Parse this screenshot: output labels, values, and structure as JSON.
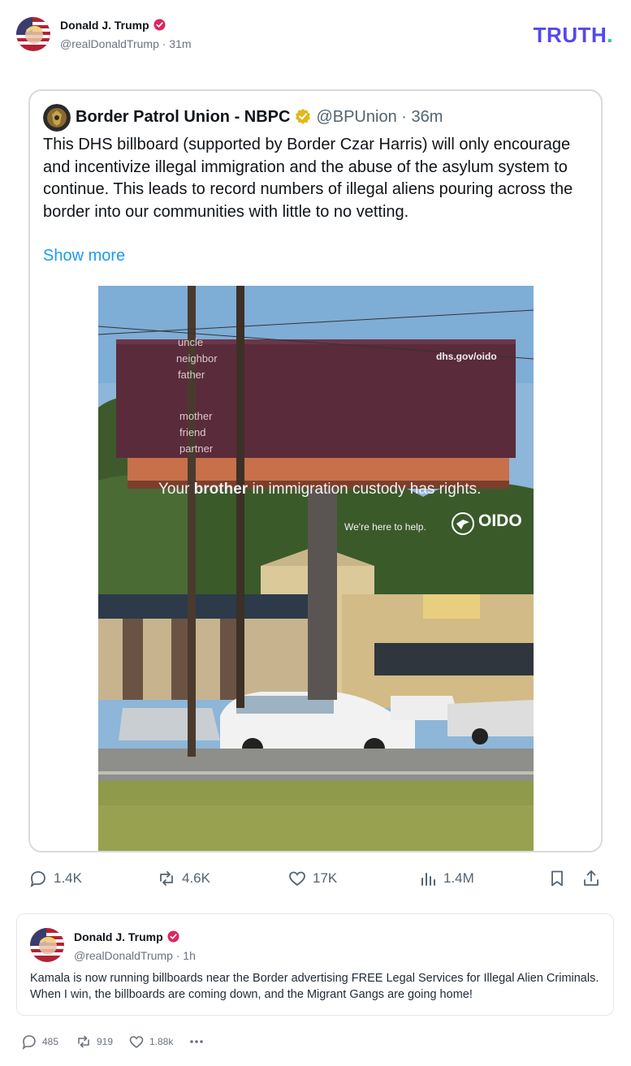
{
  "header": {
    "name": "Donald J. Trump",
    "handle_time": "@realDonaldTrump · 31m",
    "logo_main": "TRUTH",
    "logo_dot": "."
  },
  "embedded": {
    "author": "Border Patrol Union - NBPC",
    "handle_time": "@BPUnion · 36m",
    "text": "This DHS billboard (supported by Border Czar Harris) will only encourage and incentivize illegal immigration and the abuse of the asylum system to continue. This leads to record numbers of illegal aliens pouring across the border into our communities with little to no vetting.",
    "show_more": "Show more",
    "billboard": {
      "url": "dhs.gov/oido",
      "stack_top": [
        "uncle",
        "neighbor",
        "father"
      ],
      "main_pre": "Your ",
      "main_bold": "brother",
      "main_post": " in immigration custody has rights.",
      "stack_bottom": [
        "mother",
        "friend",
        "partner"
      ],
      "tagline": "We're here to help.",
      "logo": "OIDO"
    },
    "stats": {
      "replies": "1.4K",
      "reposts": "4.6K",
      "likes": "17K",
      "views": "1.4M"
    }
  },
  "post": {
    "name": "Donald J. Trump",
    "handle_time": "@realDonaldTrump · 1h",
    "text": "Kamala is now running billboards near the Border advertising FREE Legal Services for Illegal Alien Criminals. When I win, the billboards are coming down, and the Migrant Gangs are going home!"
  },
  "actions": {
    "replies": "485",
    "retruths": "919",
    "likes": "1.88k"
  },
  "colors": {
    "truth_brand": "#5448ee",
    "truth_dot": "#21c7a0",
    "verified_red": "#e0245e",
    "gold_check": "#e2b719",
    "link_blue": "#1d9bf0"
  }
}
